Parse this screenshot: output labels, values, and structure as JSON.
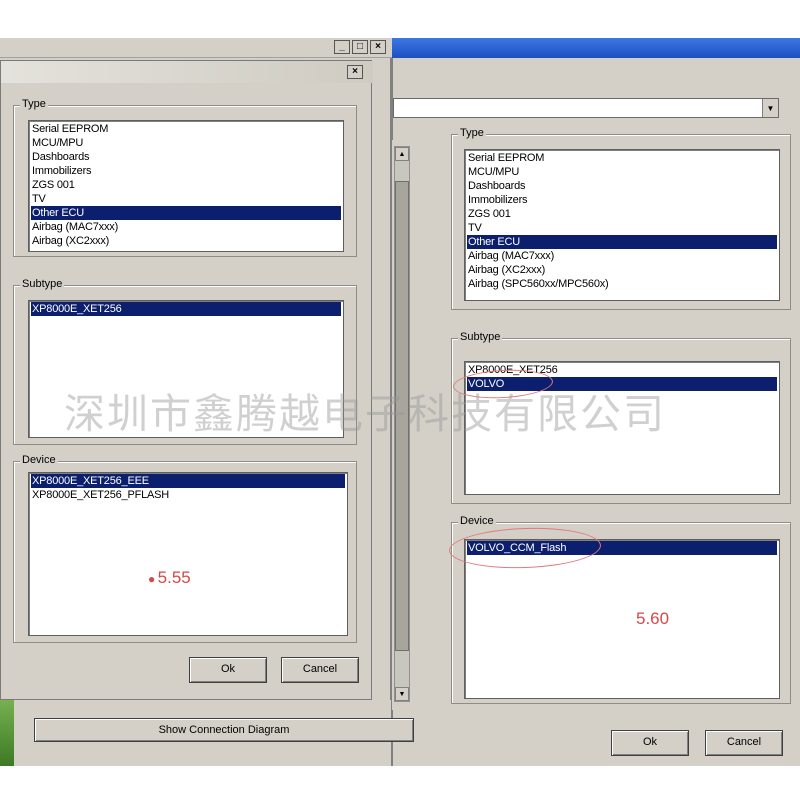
{
  "left_dialog": {
    "type_label": "Type",
    "type_items": [
      "Serial EEPROM",
      "MCU/MPU",
      "Dashboards",
      "Immobilizers",
      "ZGS 001",
      "TV",
      "Other ECU",
      "Airbag (MAC7xxx)",
      "Airbag (XC2xxx)"
    ],
    "type_selected": "Other ECU",
    "subtype_label": "Subtype",
    "subtype_items": [
      "XP8000E_XET256"
    ],
    "device_label": "Device",
    "device_items": [
      "XP8000E_XET256_EEE",
      "XP8000E_XET256_PFLASH"
    ],
    "version": "5.55",
    "ok_label": "Ok",
    "cancel_label": "Cancel"
  },
  "right_dialog": {
    "type_label": "Type",
    "type_items": [
      "Serial EEPROM",
      "MCU/MPU",
      "Dashboards",
      "Immobilizers",
      "ZGS 001",
      "TV",
      "Other ECU",
      "Airbag (MAC7xxx)",
      "Airbag (XC2xxx)",
      "Airbag (SPC560xx/MPC560x)"
    ],
    "type_selected": "Other ECU",
    "subtype_label": "Subtype",
    "subtype_items": [
      "XP8000E_XET256",
      "VOLVO"
    ],
    "device_label": "Device",
    "device_items": [
      "VOLVO_CCM_Flash"
    ],
    "version": "5.60",
    "ok_label": "Ok",
    "cancel_label": "Cancel"
  },
  "show_connection_label": "Show Connection Diagram",
  "watermark": "深圳市鑫腾越电子科技有限公司",
  "colors": {
    "selection": "#0b1f6e",
    "dialog_bg": "#d4d0c8",
    "annotation": "#d74848"
  }
}
